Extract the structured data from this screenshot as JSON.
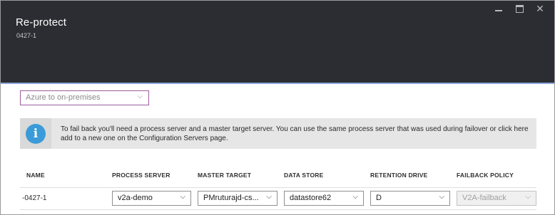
{
  "blade": {
    "title": "Re-protect",
    "subtitle": "0427-1",
    "controls": {
      "minimize": "minimize",
      "maximize": "maximize",
      "close": "✕"
    }
  },
  "direction": {
    "selected": "Azure to on-premises"
  },
  "info": {
    "icon": "i",
    "message": "To fail back you'll need a process server and a master target server. You can use the same process server that was used during failover or click here add to a new one on the Configuration Servers page."
  },
  "table": {
    "headers": [
      "NAME",
      "PROCESS SERVER",
      "MASTER TARGET",
      "DATA STORE",
      "RETENTION DRIVE",
      "FAILBACK POLICY"
    ],
    "rows": [
      {
        "name": "-0427-1",
        "process_server": "v2a-demo",
        "master_target": "PMruturajd-cs...",
        "data_store": "datastore62",
        "retention_drive": "D",
        "failback_policy": "V2A-failback"
      }
    ]
  },
  "icons": {
    "chevron": "⌵"
  },
  "colors": {
    "header_bg": "#2b2d32",
    "accent": "#9b5b9d",
    "info_blue": "#3a9bd8"
  }
}
